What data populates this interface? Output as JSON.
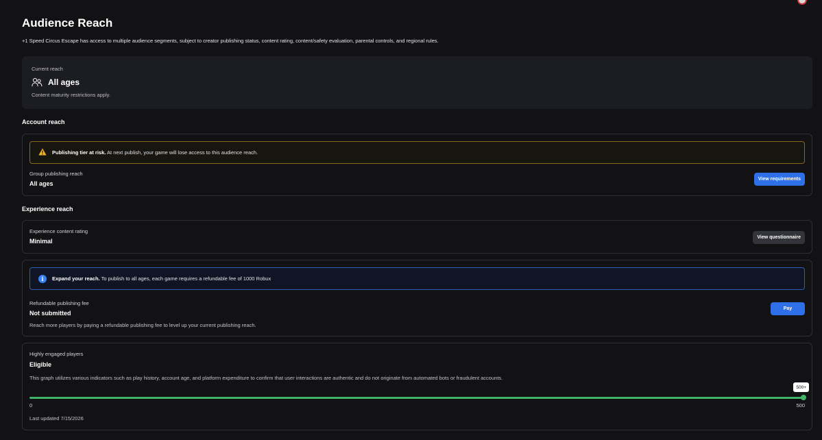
{
  "page": {
    "title": "Audience Reach",
    "subtitle": "+1 Speed Circus Escape has access to multiple audience segments, subject to creator publishing status, content rating, content/safety evaluation, parental controls, and regional rules."
  },
  "current_reach": {
    "label": "Current reach",
    "value": "All ages",
    "icon": "people-icon",
    "note": "Content maturity restrictions apply."
  },
  "account_reach": {
    "heading": "Account reach",
    "alert_title": "Publishing tier at risk.",
    "alert_message": "At next publish, your game will lose access to this audience reach.",
    "field_label": "Group publishing reach",
    "field_value": "All ages",
    "button": "View requirements"
  },
  "experience_reach": {
    "heading": "Experience reach",
    "rating_label": "Experience content rating",
    "rating_value": "Minimal",
    "rating_button": "View questionnaire",
    "info_title": "Expand your reach.",
    "info_message": "To publish to all ages, each game requires a refundable fee of 1000 Robux",
    "fee_label": "Refundable publishing fee",
    "fee_value": "Not submitted",
    "fee_desc": "Reach more players by paying a refundable publishing fee to level up your current publishing reach.",
    "pay_button": "Pay"
  },
  "engaged": {
    "label": "Highly engaged players",
    "value": "Eligible",
    "desc": "This graph utilizes various indicators such as play history, account age, and platform expenditure to confirm that user interactions are authentic and do not originate from automated bots or fraudulent accounts.",
    "slider_min": "0",
    "slider_max": "500",
    "tooltip": "500+",
    "fill_fraction": 1.0,
    "updated": "Last updated 7/15/2026"
  },
  "colors": {
    "accent_blue": "#2f6fe8",
    "warning_border": "#8a6a1f",
    "success_green": "#3fb56a"
  }
}
